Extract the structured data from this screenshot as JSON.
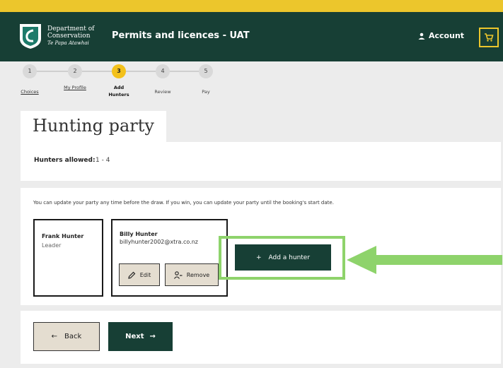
{
  "header": {
    "logo_line1": "Department of",
    "logo_line2": "Conservation",
    "logo_line3": "Te Papa Atawhai",
    "app_title": "Permits and licences - UAT",
    "account_label": "Account"
  },
  "steps": [
    {
      "number": "1",
      "label": "Choices"
    },
    {
      "number": "2",
      "label": "My Profile"
    },
    {
      "number": "3",
      "label": "Add Hunters"
    },
    {
      "number": "4",
      "label": "Review"
    },
    {
      "number": "5",
      "label": "Pay"
    }
  ],
  "active_step": 3,
  "page": {
    "title": "Hunting party",
    "hunters_allowed_label": "Hunters allowed:",
    "hunters_allowed_value": "1 - 4",
    "info_text": "You can update your party any time before the draw. If you win, you can update your party until the booking's start date."
  },
  "hunters": [
    {
      "name": "Frank Hunter",
      "detail": "Leader"
    },
    {
      "name": "Billy Hunter",
      "detail": "billyhunter2002@xtra.co.nz",
      "edit_label": "Edit",
      "remove_label": "Remove"
    }
  ],
  "actions": {
    "add_hunter_label": "Add a hunter",
    "back_label": "Back",
    "next_label": "Next"
  },
  "colors": {
    "brand_dark": "#173f35",
    "accent_yellow": "#ecc62c",
    "highlight_green": "#8ed36b"
  }
}
